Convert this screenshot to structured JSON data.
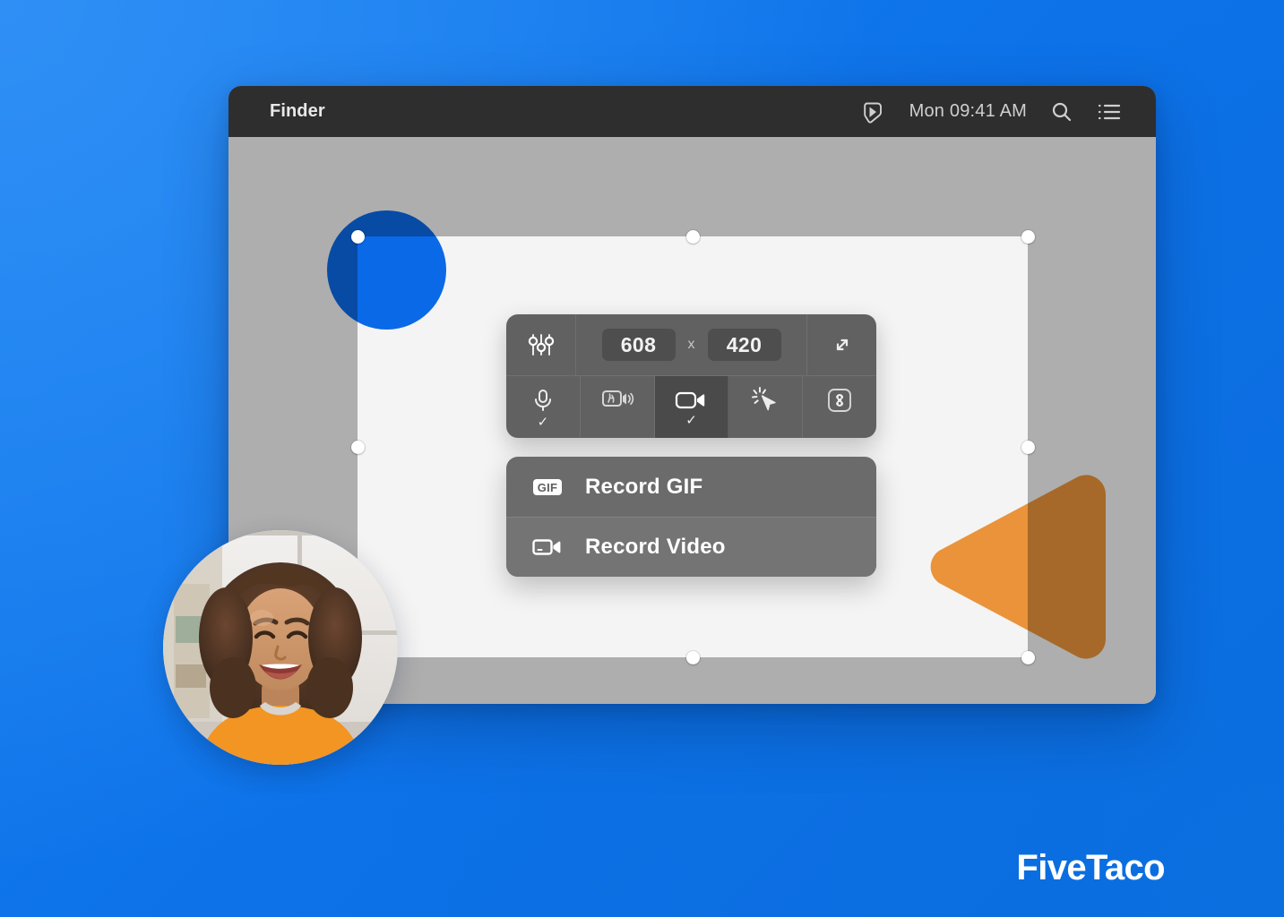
{
  "brand": {
    "name": "FiveTaco"
  },
  "window": {
    "menubar": {
      "apple_glyph": "",
      "app_name": "Finder",
      "clock": "Mon 09:41 AM",
      "icons": [
        "cleanshot-icon",
        "search-icon",
        "control-center-icon"
      ]
    }
  },
  "toolbar": {
    "settings_label": "settings-sliders-icon",
    "width": "608",
    "separator": "x",
    "height": "420",
    "expand_label": "expand-icon",
    "tools": [
      {
        "name": "microphone",
        "icon": "microphone-icon",
        "checked": true,
        "check": "✓"
      },
      {
        "name": "system-audio",
        "icon": "system-audio-icon",
        "checked": false,
        "check": "✓"
      },
      {
        "name": "camera",
        "icon": "camera-icon",
        "checked": true,
        "active": true,
        "check": "✓"
      },
      {
        "name": "mouse-click-highlight",
        "icon": "cursor-click-icon",
        "checked": false,
        "check": "✓"
      },
      {
        "name": "keystrokes",
        "icon": "command-key-icon",
        "checked": false,
        "check": "✓"
      }
    ]
  },
  "menu": {
    "items": [
      {
        "label": "Record GIF",
        "icon": "gif-icon",
        "badge": "GIF",
        "hovered": false
      },
      {
        "label": "Record Video",
        "icon": "video-camera-icon",
        "badge": "",
        "hovered": true
      }
    ]
  },
  "colors": {
    "background_blue": "#0d72e8",
    "window_desktop": "#aeaeae",
    "canvas": "#f4f4f4",
    "menubar": "#2e2e2e",
    "toolbar": "#616161",
    "toolbar_active_cell": "#4a4a4a",
    "menu": "#6b6b6b",
    "shape_circle": "#0a6ef2",
    "shape_triangle": "#f59a3c",
    "text_primary": "#ffffff"
  },
  "shapes": {
    "circle": "blue-circle-shape",
    "triangle": "orange-triangle-shape"
  },
  "selection": {
    "handles": [
      "top-left",
      "top-center",
      "top-right",
      "middle-left",
      "middle-right",
      "bottom-center",
      "bottom-right"
    ]
  },
  "webcam": {
    "label": "webcam-bubble"
  }
}
